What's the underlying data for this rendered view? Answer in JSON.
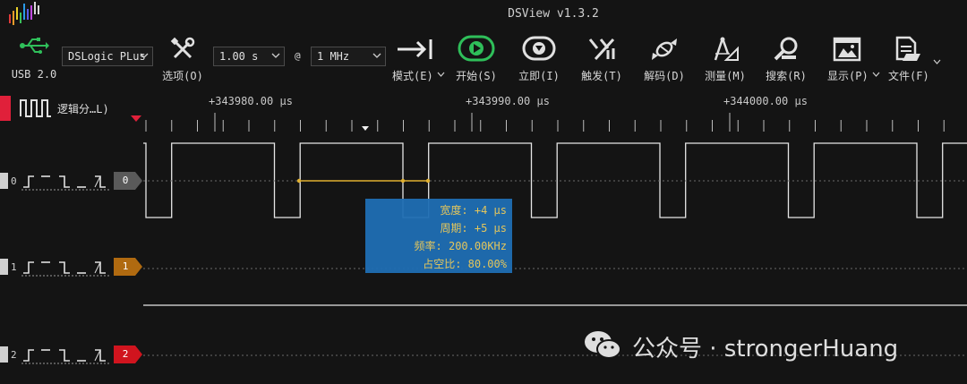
{
  "window": {
    "title": "DSView v1.3.2"
  },
  "toolbar": {
    "usb": {
      "label": "USB 2.0",
      "icon": "usb-icon"
    },
    "device": {
      "value": "DSLogic PLus"
    },
    "options": {
      "label": "选项(O)",
      "icon": "wrench-screwdriver-icon"
    },
    "sample_time": {
      "value": "1.00 s"
    },
    "at_sign": "@",
    "sample_rate": {
      "value": "1 MHz"
    },
    "mode": {
      "label": "模式(E)",
      "icon": "arrow-to-bar-icon"
    },
    "start": {
      "label": "开始(S)",
      "icon": "play-circle-icon",
      "color": "#2fbf5a"
    },
    "instant": {
      "label": "立即(I)",
      "icon": "instant-capture-icon"
    },
    "trigger": {
      "label": "触发(T)",
      "icon": "trigger-icon"
    },
    "decode": {
      "label": "解码(D)",
      "icon": "decode-candy-icon"
    },
    "measure": {
      "label": "测量(M)",
      "icon": "compass-ruler-icon"
    },
    "search": {
      "label": "搜索(R)",
      "icon": "magnifier-icon"
    },
    "display": {
      "label": "显示(P)",
      "icon": "display-window-icon"
    },
    "file": {
      "label": "文件(F)",
      "icon": "file-folder-icon"
    }
  },
  "ruler": {
    "labels": [
      "+343980.00 μs",
      "+343990.00 μs",
      "+344000.00 μs"
    ]
  },
  "group": {
    "label": "逻辑分…L)",
    "color": "#e0203a"
  },
  "channels": [
    {
      "index": "0",
      "tag": "0",
      "tag_color": "#5a5a5a"
    },
    {
      "index": "1",
      "tag": "1",
      "tag_color": "#b06a10"
    },
    {
      "index": "2",
      "tag": "2",
      "tag_color": "#d0141e"
    }
  ],
  "measurement": {
    "width": "宽度: +4 μs",
    "period": "周期: +5 μs",
    "frequency": "频率: 200.00KHz",
    "duty": "占空比: 80.00%"
  },
  "watermark": {
    "text": "公众号 · strongerHuang"
  }
}
